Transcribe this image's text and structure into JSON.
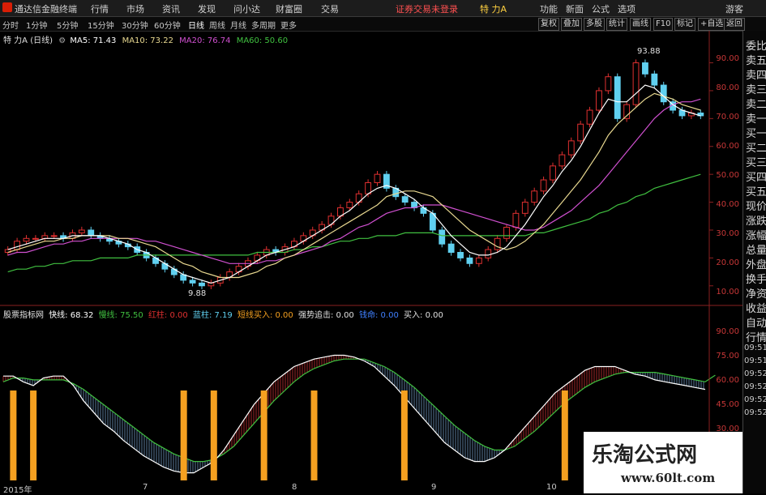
{
  "topbar": {
    "app_title": "通达信金融终端",
    "menus": [
      "行情",
      "市场",
      "资讯",
      "发现",
      "问小达",
      "财富圈",
      "交易"
    ],
    "alert": "证券交易未登录",
    "stock_name": "特 力A",
    "right_menus": [
      "功能",
      "新面",
      "公式",
      "选项"
    ],
    "user": "游客"
  },
  "timeframes": [
    "分时",
    "1分钟",
    "5分钟",
    "15分钟",
    "30分钟",
    "60分钟",
    "日线",
    "周线",
    "月线",
    "多周期",
    "更多"
  ],
  "active_timeframe": "日线",
  "right_buttons": [
    "复权",
    "叠加",
    "多股",
    "统计",
    "画线",
    "F10",
    "标记",
    "+自选",
    "返回"
  ],
  "main_legend": {
    "title": "特 力A (日线)",
    "ma5": "MA5: 71.43",
    "ma10": "MA10: 73.22",
    "ma20": "MA20: 76.74",
    "ma60": "MA60: 50.60"
  },
  "sub_legend": {
    "title": "股票指标网",
    "fast": "快线: 68.32",
    "slow": "慢线: 75.50",
    "red": "红柱: 0.00",
    "blue": "蓝柱: 7.19",
    "short_buy": "短线买入: 0.00",
    "strong": "强势追击: 0.00",
    "dot_label": "钱命: 0.00",
    "buy": "买入: 0.00"
  },
  "price_axis": [
    "90.00",
    "80.00",
    "70.00",
    "60.00",
    "50.00",
    "40.00",
    "30.00",
    "20.00",
    "10.00"
  ],
  "indicator_axis": [
    "90.00",
    "75.00",
    "60.00",
    "45.00",
    "30.00"
  ],
  "annotations": {
    "high": "93.88",
    "low": "9.88"
  },
  "date_axis": [
    "2015年",
    "7",
    "8",
    "9",
    "10"
  ],
  "sidebar_items": [
    "委比",
    "卖五",
    "卖四",
    "卖三",
    "卖二",
    "卖一",
    "买一",
    "买二",
    "买三",
    "买四",
    "买五",
    "现价",
    "涨跌",
    "涨幅",
    "总量",
    "外盘",
    "换手",
    "净资",
    "收益",
    "自动",
    "行情"
  ],
  "sidebar_times": [
    "09:51",
    "09:51",
    "09:52",
    "09:52",
    "09:52",
    "09:52"
  ],
  "watermark": {
    "title": "乐淘公式网",
    "url": "www.60lt.com"
  },
  "colors": {
    "up": "#e03030",
    "down": "#60d0f0",
    "ma5": "#ffffff",
    "ma10": "#e8d890",
    "ma20": "#d050d0",
    "ma60": "#40c040",
    "signal": "#f5a020"
  },
  "chart_data": {
    "type": "candlestick",
    "price_ylim": [
      5,
      98
    ],
    "close": [
      23,
      26,
      27,
      27,
      28,
      28,
      27,
      29,
      30,
      28,
      27,
      26,
      25,
      24,
      22,
      20,
      18,
      16,
      14,
      12,
      11,
      10,
      11,
      13,
      15,
      17,
      19,
      21,
      23,
      22,
      24,
      26,
      28,
      30,
      32,
      35,
      38,
      40,
      43,
      47,
      50,
      45,
      42,
      40,
      38,
      36,
      30,
      25,
      22,
      20,
      18,
      20,
      23,
      27,
      31,
      36,
      40,
      44,
      48,
      53,
      57,
      62,
      68,
      73,
      80,
      85,
      70,
      75,
      90,
      86,
      82,
      76,
      73,
      71,
      72,
      71
    ],
    "ma5": [
      23,
      24,
      25,
      26,
      27,
      27,
      27,
      28,
      28,
      28,
      28,
      27,
      26,
      25,
      23,
      22,
      20,
      18,
      16,
      14,
      13,
      12,
      11,
      12,
      13,
      15,
      17,
      19,
      21,
      22,
      23,
      24,
      26,
      28,
      30,
      32,
      35,
      37,
      40,
      43,
      45,
      46,
      45,
      43,
      41,
      38,
      36,
      32,
      28,
      25,
      22,
      21,
      21,
      22,
      24,
      28,
      32,
      37,
      42,
      46,
      51,
      55,
      60,
      66,
      72,
      77,
      76,
      76,
      79,
      82,
      81,
      78,
      75,
      73,
      72,
      71
    ],
    "ma10": [
      22,
      23,
      24,
      25,
      26,
      26,
      27,
      27,
      28,
      28,
      28,
      28,
      27,
      27,
      26,
      25,
      24,
      22,
      20,
      18,
      17,
      15,
      14,
      13,
      13,
      13,
      14,
      15,
      17,
      18,
      20,
      21,
      23,
      25,
      27,
      29,
      31,
      33,
      35,
      37,
      39,
      42,
      43,
      44,
      44,
      43,
      42,
      39,
      36,
      33,
      30,
      28,
      26,
      24,
      23,
      24,
      26,
      29,
      32,
      36,
      40,
      44,
      48,
      53,
      58,
      64,
      68,
      71,
      74,
      77,
      79,
      78,
      77,
      75,
      74,
      73
    ],
    "ma20": [
      21,
      22,
      22,
      23,
      24,
      25,
      25,
      26,
      26,
      27,
      27,
      27,
      27,
      27,
      27,
      26,
      26,
      25,
      24,
      23,
      22,
      21,
      20,
      19,
      18,
      18,
      18,
      18,
      19,
      19,
      20,
      21,
      22,
      23,
      24,
      26,
      27,
      29,
      31,
      32,
      34,
      36,
      37,
      38,
      38,
      39,
      39,
      39,
      38,
      37,
      36,
      35,
      34,
      33,
      32,
      31,
      30,
      30,
      31,
      33,
      35,
      37,
      40,
      43,
      46,
      50,
      54,
      58,
      62,
      66,
      70,
      73,
      75,
      76,
      76,
      77
    ],
    "ma60": [
      15,
      16,
      16,
      17,
      17,
      18,
      18,
      19,
      19,
      19,
      20,
      20,
      20,
      20,
      21,
      21,
      21,
      21,
      21,
      21,
      21,
      21,
      21,
      21,
      21,
      21,
      21,
      22,
      22,
      22,
      22,
      23,
      23,
      24,
      24,
      25,
      26,
      26,
      27,
      27,
      28,
      28,
      28,
      29,
      29,
      29,
      29,
      28,
      28,
      28,
      28,
      28,
      28,
      28,
      28,
      28,
      28,
      29,
      29,
      30,
      31,
      32,
      33,
      34,
      36,
      37,
      39,
      40,
      42,
      43,
      45,
      46,
      47,
      48,
      49,
      50
    ],
    "indicator_ylim": [
      20,
      105
    ],
    "fast": [
      75,
      75,
      72,
      70,
      74,
      75,
      75,
      70,
      62,
      56,
      50,
      46,
      41,
      37,
      33,
      30,
      27,
      25,
      24,
      24,
      27,
      30,
      36,
      44,
      52,
      60,
      66,
      72,
      76,
      80,
      82,
      84,
      85,
      86,
      86,
      85,
      83,
      80,
      75,
      70,
      64,
      58,
      52,
      46,
      40,
      36,
      32,
      30,
      30,
      32,
      36,
      42,
      48,
      54,
      60,
      66,
      70,
      74,
      78,
      80,
      80,
      80,
      78,
      76,
      75,
      73,
      72,
      71,
      70,
      69,
      68
    ],
    "slow": [
      72,
      74,
      74,
      73,
      73,
      73,
      73,
      71,
      68,
      64,
      60,
      56,
      52,
      48,
      44,
      40,
      37,
      34,
      32,
      30,
      30,
      31,
      34,
      38,
      44,
      50,
      56,
      62,
      67,
      72,
      76,
      79,
      81,
      83,
      84,
      84,
      84,
      82,
      80,
      77,
      73,
      69,
      64,
      59,
      54,
      49,
      45,
      41,
      38,
      36,
      36,
      38,
      42,
      46,
      51,
      56,
      61,
      65,
      69,
      72,
      74,
      76,
      77,
      77,
      77,
      77,
      76,
      75,
      74,
      73,
      72,
      75.5
    ],
    "signal_bars_index": [
      1,
      3,
      18,
      21,
      26,
      31,
      40,
      56
    ]
  }
}
